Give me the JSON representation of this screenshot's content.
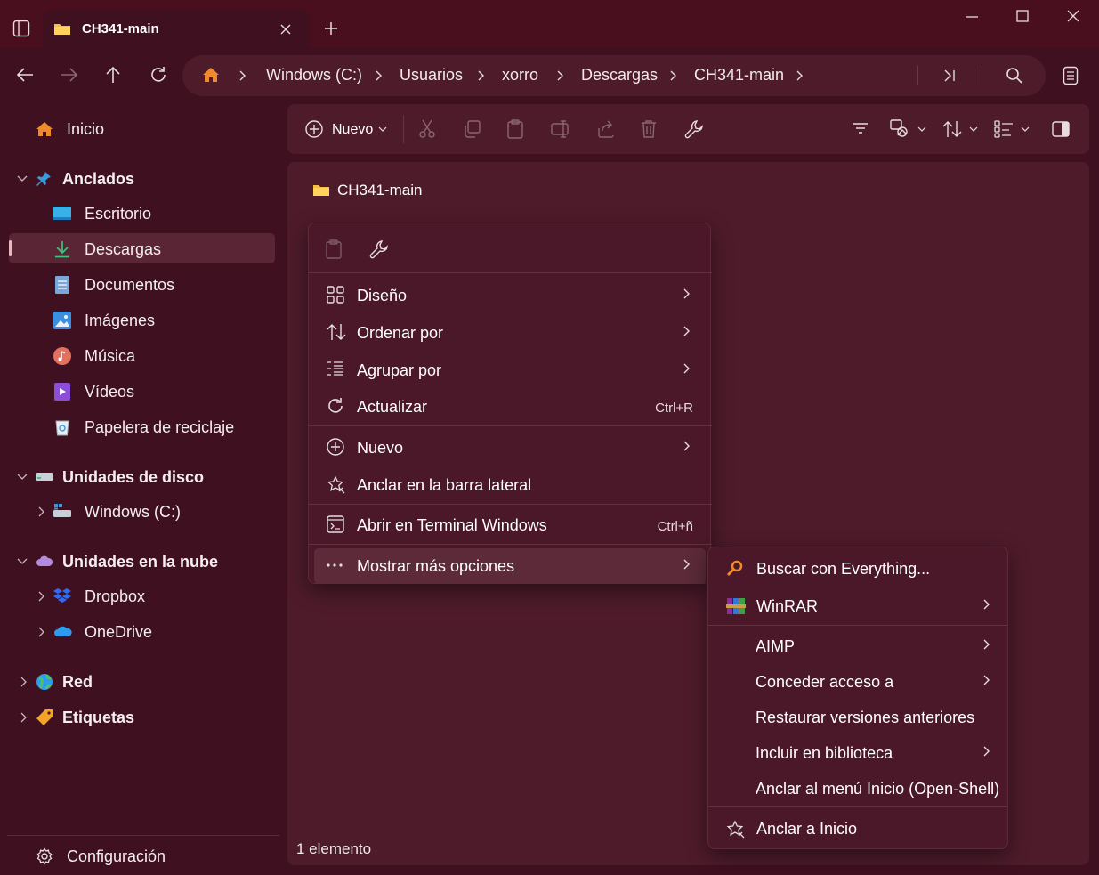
{
  "window": {
    "tab_title": "CH341-main",
    "colors": {
      "background": "#3f1020",
      "panel": "#4e1b2b",
      "accent": "#e8b7c4"
    }
  },
  "nav": {
    "breadcrumbs": [
      "Windows (C:)",
      "Usuarios",
      "xorro",
      "Descargas",
      "CH341-main"
    ]
  },
  "commandbar": {
    "new_label": "Nuevo"
  },
  "sidebar": {
    "home": "Inicio",
    "pinned_header": "Anclados",
    "pinned": [
      "Escritorio",
      "Descargas",
      "Documentos",
      "Imágenes",
      "Música",
      "Vídeos",
      "Papelera de reciclaje"
    ],
    "drives_header": "Unidades de disco",
    "drives": [
      "Windows (C:)"
    ],
    "cloud_header": "Unidades en la nube",
    "cloud": [
      "Dropbox",
      "OneDrive"
    ],
    "network": "Red",
    "tags": "Etiquetas",
    "settings": "Configuración"
  },
  "content": {
    "folder_title": "CH341-main",
    "status": "1 elemento"
  },
  "context_menu": {
    "items": [
      {
        "label": "Diseño",
        "icon": "layout-icon"
      },
      {
        "label": "Ordenar por",
        "icon": "sort-icon"
      },
      {
        "label": "Agrupar por",
        "icon": "group-icon"
      },
      {
        "label": "Actualizar",
        "icon": "refresh-icon",
        "shortcut": "Ctrl+R"
      },
      {
        "label": "Nuevo",
        "icon": "new-icon"
      },
      {
        "label": "Anclar en la barra lateral",
        "icon": "pin-star-icon"
      },
      {
        "label": "Abrir en Terminal Windows",
        "icon": "terminal-icon",
        "shortcut": "Ctrl+ñ"
      },
      {
        "label": "Mostrar más opciones",
        "icon": "more-icon"
      }
    ]
  },
  "submenu": {
    "items": [
      {
        "label": "Buscar con Everything...",
        "icon": "everything-search-icon"
      },
      {
        "label": "WinRAR",
        "icon": "winrar-icon"
      },
      {
        "label": "AIMP"
      },
      {
        "label": "Conceder acceso a"
      },
      {
        "label": "Restaurar versiones anteriores"
      },
      {
        "label": "Incluir en biblioteca"
      },
      {
        "label": "Anclar al menú Inicio (Open-Shell)"
      },
      {
        "label": "Anclar a Inicio",
        "icon": "pin-star-icon"
      }
    ]
  }
}
